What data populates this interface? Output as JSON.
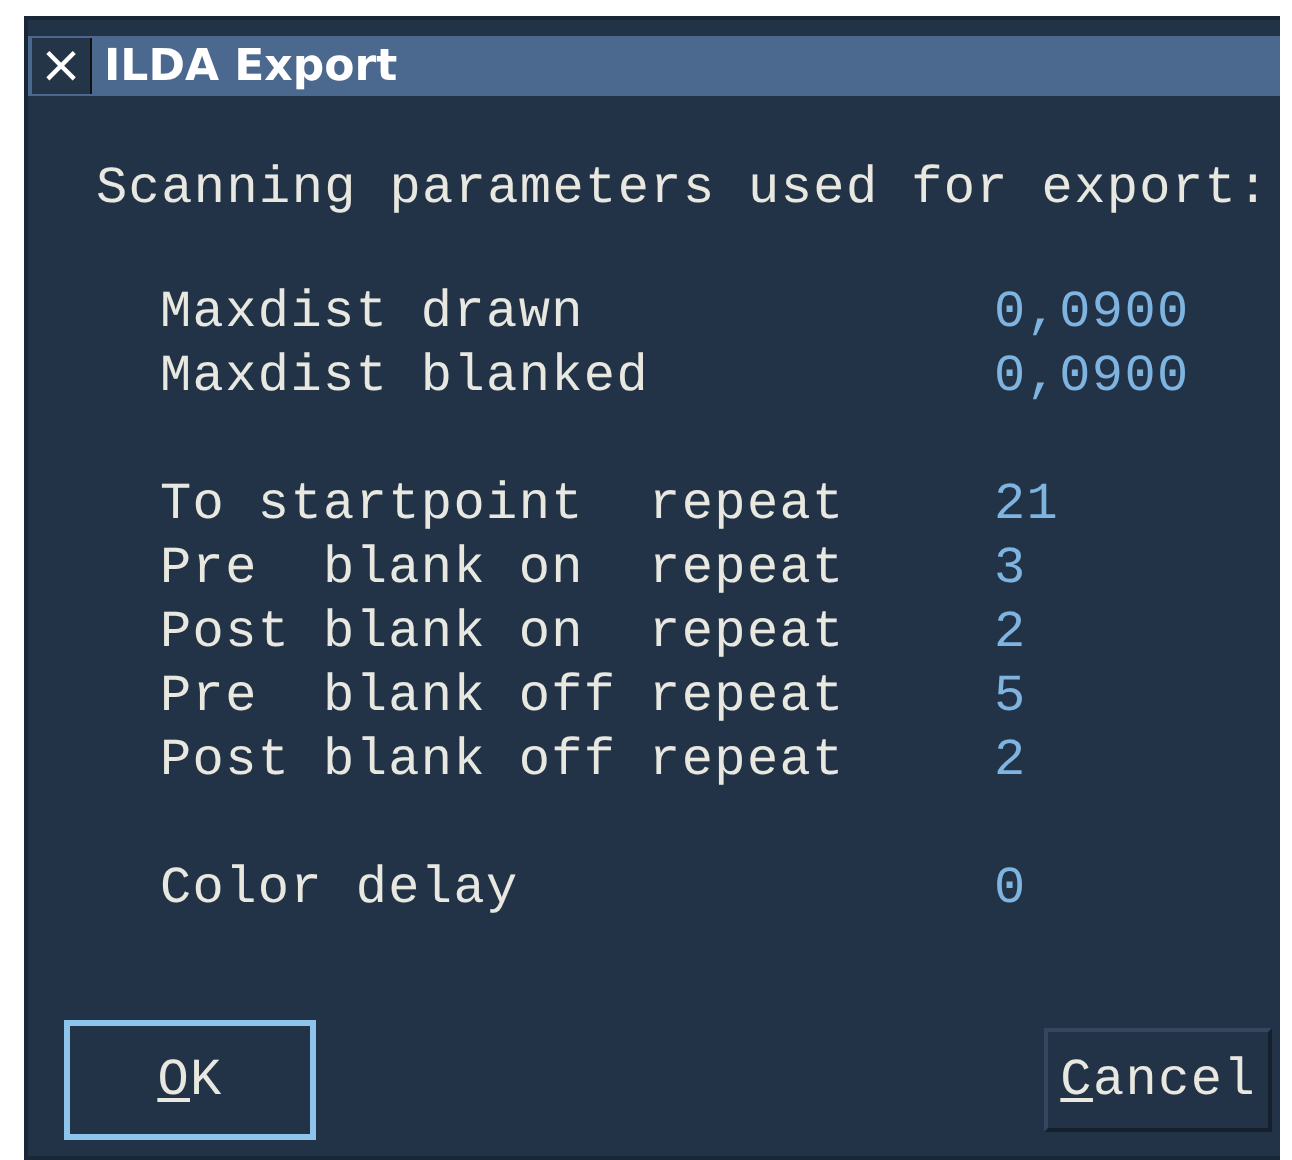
{
  "window": {
    "title": "ILDA Export",
    "close_glyph": "×"
  },
  "heading": "Scanning parameters used for export:",
  "parameter_groups": [
    [
      {
        "label": "Maxdist drawn",
        "value": "0,0900"
      },
      {
        "label": "Maxdist blanked",
        "value": "0,0900"
      }
    ],
    [
      {
        "label": "To startpoint  repeat",
        "value": "21"
      },
      {
        "label": "Pre  blank on  repeat",
        "value": "3"
      },
      {
        "label": "Post blank on  repeat",
        "value": "2"
      },
      {
        "label": "Pre  blank off repeat",
        "value": "5"
      },
      {
        "label": "Post blank off repeat",
        "value": "2"
      }
    ],
    [
      {
        "label": "Color delay",
        "value": "0"
      }
    ]
  ],
  "buttons": [
    {
      "label": "OK",
      "focused": true
    },
    {
      "label": "Cancel",
      "focused": false
    }
  ]
}
